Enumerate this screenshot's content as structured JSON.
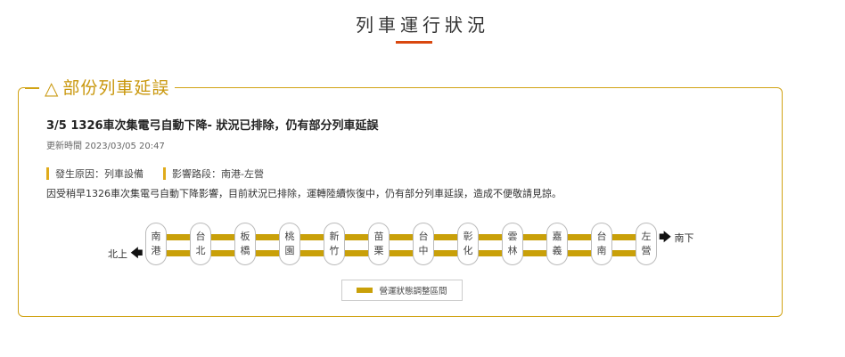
{
  "page": {
    "title": "列車運行狀況"
  },
  "alert": {
    "legend_icon": "warning-triangle-icon",
    "legend_icon_glyph": "△",
    "legend_title": "部份列車延誤",
    "headline": "3/5 1326車次集電弓自動下降- 狀況已排除，仍有部分列車延誤",
    "update_time": "更新時間 2023/03/05 20:47",
    "cause": "發生原因：列車設備",
    "affected_section": "影響路段：南港-左營",
    "description": "因受稍早1326車次集電弓自動下降影響，目前狀況已排除，運轉陸續恢復中，仍有部分列車延誤，造成不便敬請見諒。",
    "accent_color": "#c9970c"
  },
  "route_map": {
    "north_label": "北上",
    "south_label": "南下",
    "north_arrow_icon": "arrow-left-icon",
    "south_arrow_icon": "arrow-right-icon",
    "stations": [
      {
        "id": "nangang",
        "chars": [
          "南",
          "港"
        ]
      },
      {
        "id": "taipei",
        "chars": [
          "台",
          "北"
        ]
      },
      {
        "id": "banqiao",
        "chars": [
          "板",
          "橋"
        ]
      },
      {
        "id": "taoyuan",
        "chars": [
          "桃",
          "園"
        ]
      },
      {
        "id": "hsinchu",
        "chars": [
          "新",
          "竹"
        ]
      },
      {
        "id": "miaoli",
        "chars": [
          "苗",
          "栗"
        ]
      },
      {
        "id": "taichung",
        "chars": [
          "台",
          "中"
        ]
      },
      {
        "id": "changhua",
        "chars": [
          "彰",
          "化"
        ]
      },
      {
        "id": "yunlin",
        "chars": [
          "雲",
          "林"
        ]
      },
      {
        "id": "chiayi",
        "chars": [
          "嘉",
          "義"
        ]
      },
      {
        "id": "tainan",
        "chars": [
          "台",
          "南"
        ]
      },
      {
        "id": "zuoying",
        "chars": [
          "左",
          "營"
        ]
      }
    ],
    "track_color": "#c9a009",
    "legend_label": "營運狀態調整區間"
  }
}
